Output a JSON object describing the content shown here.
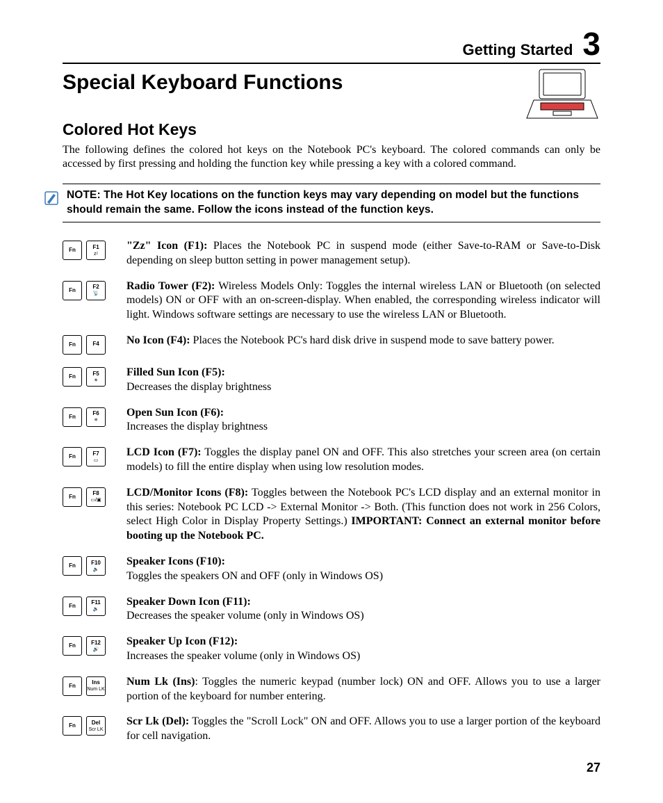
{
  "header": {
    "section_title": "Getting Started",
    "chapter_number": "3"
  },
  "titles": {
    "h1": "Special Keyboard Functions",
    "h2": "Colored Hot Keys"
  },
  "intro_paragraph": "The following defines the colored hot keys on the Notebook PC's keyboard. The colored commands can only be accessed by first pressing and holding the function key while pressing a key with a colored command.",
  "note": {
    "prefix": "NOTE:",
    "text": "The Hot Key locations on the function keys may vary depending on model but the functions should remain the same. Follow the icons instead of the function keys."
  },
  "hotkeys": [
    {
      "fn_label": "Fn",
      "key_top": "F1",
      "key_bot_glyph": "zᶻ",
      "title": "\"Zz\" Icon (F1):",
      "body": " Places the Notebook PC in suspend mode (either Save-to-RAM or Save-to-Disk depending on sleep button setting in power management setup).",
      "trailing_bold": ""
    },
    {
      "fn_label": "Fn",
      "key_top": "F2",
      "key_bot_glyph": "📡",
      "title": "Radio Tower (F2):",
      "body": " Wireless Models Only: Toggles the internal wireless LAN or Bluetooth (on selected models) ON or OFF with an on-screen-display. When enabled, the corresponding wireless indicator will light. Windows software settings are necessary to use the wireless LAN or Bluetooth.",
      "trailing_bold": ""
    },
    {
      "fn_label": "Fn",
      "key_top": "F4",
      "key_bot_glyph": "",
      "title": "No Icon (F4):",
      "body": " Places the Notebook PC's hard disk drive in suspend mode to save battery power.",
      "trailing_bold": ""
    },
    {
      "fn_label": "Fn",
      "key_top": "F5",
      "key_bot_glyph": "☀",
      "title": "Filled Sun Icon (F5):",
      "body": "\nDecreases the display brightness",
      "trailing_bold": ""
    },
    {
      "fn_label": "Fn",
      "key_top": "F6",
      "key_bot_glyph": "✳",
      "title": "Open Sun Icon (F6):",
      "body": "\nIncreases the display brightness",
      "trailing_bold": ""
    },
    {
      "fn_label": "Fn",
      "key_top": "F7",
      "key_bot_glyph": "▭",
      "title": "LCD Icon (F7):",
      "body": " Toggles the display panel ON and OFF. This also stretches your screen area (on certain models) to fill the entire display when using low resolution modes.",
      "trailing_bold": ""
    },
    {
      "fn_label": "Fn",
      "key_top": "F8",
      "key_bot_glyph": "▭/▣",
      "title": "LCD/Monitor Icons (F8):",
      "body": " Toggles between the Notebook PC's LCD display and an external monitor in this series: Notebook PC LCD -> External Monitor -> Both. (This function does not work in 256 Colors, select High Color in Display Property Settings.) ",
      "trailing_bold": "IMPORTANT: Connect an external monitor before booting up the Notebook PC."
    },
    {
      "fn_label": "Fn",
      "key_top": "F10",
      "key_bot_glyph": "🔈",
      "title": "Speaker Icons (F10):",
      "body": "\nToggles the speakers ON and OFF (only in Windows OS)",
      "trailing_bold": ""
    },
    {
      "fn_label": "Fn",
      "key_top": "F11",
      "key_bot_glyph": "🔉",
      "title": "Speaker Down Icon (F11):",
      "body": "\nDecreases the speaker volume (only in Windows OS)",
      "trailing_bold": ""
    },
    {
      "fn_label": "Fn",
      "key_top": "F12",
      "key_bot_glyph": "🔊",
      "title": "Speaker Up Icon (F12):",
      "body": "\nIncreases the speaker volume (only in Windows OS)",
      "trailing_bold": ""
    },
    {
      "fn_label": "Fn",
      "key_top": "Ins",
      "key_bot_glyph": "Num LK",
      "title": "Num Lk (Ins)",
      "body": ": Toggles the numeric keypad (number lock) ON and OFF. Allows you to use a larger portion of the keyboard for number entering.",
      "trailing_bold": ""
    },
    {
      "fn_label": "Fn",
      "key_top": "Del",
      "key_bot_glyph": "Scr LK",
      "title": "Scr Lk (Del):",
      "body": " Toggles the \"Scroll Lock\" ON and OFF. Allows you to use a larger portion of the keyboard for cell navigation.",
      "trailing_bold": ""
    }
  ],
  "page_number": "27"
}
